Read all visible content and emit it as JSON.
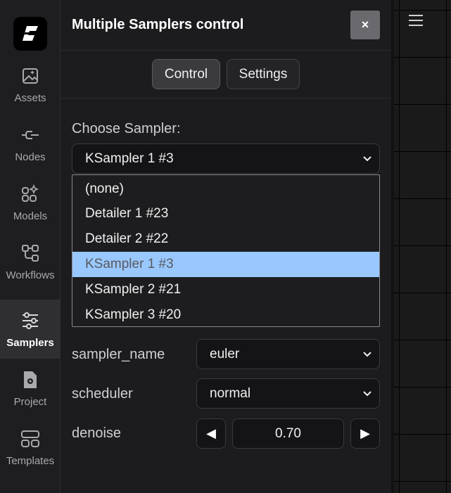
{
  "sidebar": {
    "items": [
      {
        "label": "Assets",
        "icon": "image-icon"
      },
      {
        "label": "Nodes",
        "icon": "plug-icon"
      },
      {
        "label": "Models",
        "icon": "grid-sparkle-icon"
      },
      {
        "label": "Workflows",
        "icon": "workflow-icon"
      },
      {
        "label": "Samplers",
        "icon": "sliders-icon",
        "active": true
      },
      {
        "label": "Project",
        "icon": "file-gear-icon"
      },
      {
        "label": "Templates",
        "icon": "templates-icon"
      }
    ]
  },
  "panel": {
    "title": "Multiple Samplers control",
    "close_label": "×",
    "tabs": [
      {
        "label": "Control",
        "active": true
      },
      {
        "label": "Settings",
        "active": false
      }
    ],
    "choose_label": "Choose Sampler:",
    "sampler_select_value": "KSampler 1 #3",
    "dropdown_options": [
      "(none)",
      "Detailer 1 #23",
      "Detailer 2 #22",
      "KSampler 1 #3",
      "KSampler 2 #21",
      "KSampler 3 #20"
    ],
    "selected_option_index": 3,
    "fields": {
      "sampler_name": {
        "label": "sampler_name",
        "value": "euler"
      },
      "scheduler": {
        "label": "scheduler",
        "value": "normal"
      },
      "denoise": {
        "label": "denoise",
        "value": "0.70",
        "dec_label": "◀",
        "inc_label": "▶"
      }
    }
  },
  "colors": {
    "highlight": "#99c8ff",
    "background": "#1c1c1e"
  }
}
